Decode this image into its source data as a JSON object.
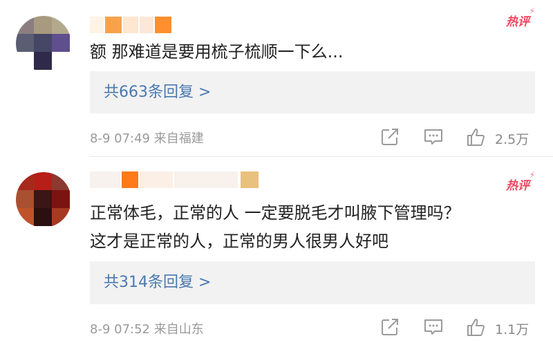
{
  "comments": [
    {
      "hot_label": "热评",
      "text_lines": [
        "额 那难道是要用梳子梳顺一下么..."
      ],
      "replies_label": "共663条回复 >",
      "time": "8-9 07:49",
      "location": "来自福建",
      "likes": "2.5万",
      "avatar_colors": [
        "#8b7d80",
        "#a79a7f",
        "#ffffff",
        "#5b5d72",
        "#d9d9e0",
        "#5f4f8c",
        "#ffffff",
        "#2f2a4a",
        "#ffffff"
      ],
      "username_colors": [
        "#f7a24a",
        "#ff8f2e",
        "#f39e58",
        "#ff7b1f"
      ]
    },
    {
      "hot_label": "热评",
      "text_lines": [
        "正常体毛，正常的人 一定要脱毛才叫腋下管理吗？",
        "这才是正常的人，正常的男人很男人好吧"
      ],
      "replies_label": "共314条回复 >",
      "time": "8-9 07:52",
      "location": "来自山东",
      "likes": "1.1万",
      "avatar_colors": [
        "#a6291b",
        "#b61e18",
        "#a42c26",
        "#8c1a14",
        "#3a1616",
        "#7a1410",
        "#c0522a",
        "#2a1010",
        "#a53a1f"
      ],
      "username_colors": [
        "#ff7a18",
        "#f4b27a",
        "#e9c17e"
      ]
    }
  ]
}
